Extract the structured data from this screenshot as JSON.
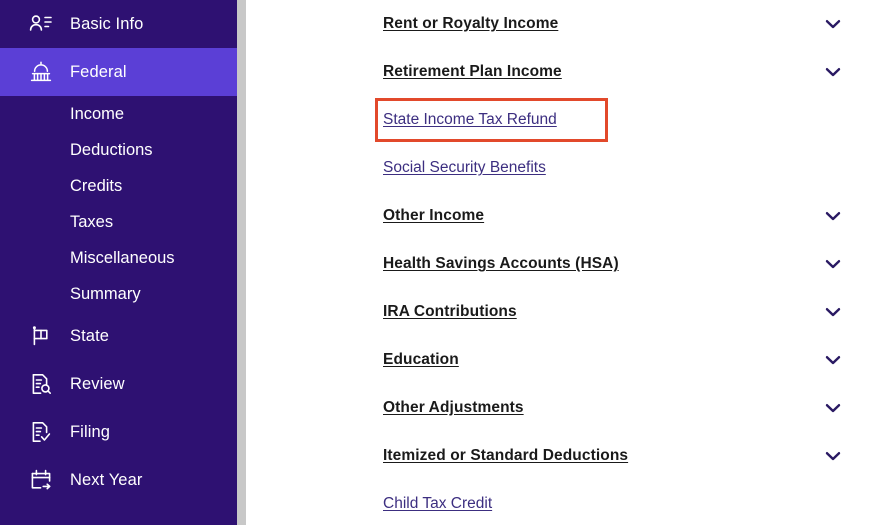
{
  "sidebar": {
    "items": [
      {
        "label": "Basic Info",
        "icon": "contact-card-icon",
        "active": false,
        "type": "nav"
      },
      {
        "label": "Federal",
        "icon": "capitol-building-icon",
        "active": true,
        "type": "nav"
      },
      {
        "label": "Income",
        "type": "sub"
      },
      {
        "label": "Deductions",
        "type": "sub"
      },
      {
        "label": "Credits",
        "type": "sub"
      },
      {
        "label": "Taxes",
        "type": "sub"
      },
      {
        "label": "Miscellaneous",
        "type": "sub"
      },
      {
        "label": "Summary",
        "type": "sub"
      },
      {
        "label": "State",
        "icon": "flag-icon",
        "active": false,
        "type": "nav"
      },
      {
        "label": "Review",
        "icon": "document-search-icon",
        "active": false,
        "type": "nav"
      },
      {
        "label": "Filing",
        "icon": "document-check-icon",
        "active": false,
        "type": "nav"
      },
      {
        "label": "Next Year",
        "icon": "calendar-arrow-icon",
        "active": false,
        "type": "nav"
      }
    ]
  },
  "main": {
    "items": [
      {
        "label": "Rent or Royalty Income",
        "style": "header",
        "chevron": true,
        "highlighted": false
      },
      {
        "label": "Retirement Plan Income",
        "style": "header",
        "chevron": true,
        "highlighted": false
      },
      {
        "label": "State Income Tax Refund",
        "style": "link",
        "chevron": false,
        "highlighted": true
      },
      {
        "label": "Social Security Benefits",
        "style": "link",
        "chevron": false,
        "highlighted": false
      },
      {
        "label": "Other Income",
        "style": "header",
        "chevron": true,
        "highlighted": false
      },
      {
        "label": "Health Savings Accounts (HSA)",
        "style": "header",
        "chevron": true,
        "highlighted": false
      },
      {
        "label": "IRA Contributions",
        "style": "header",
        "chevron": true,
        "highlighted": false
      },
      {
        "label": "Education",
        "style": "header",
        "chevron": true,
        "highlighted": false
      },
      {
        "label": "Other Adjustments",
        "style": "header",
        "chevron": true,
        "highlighted": false
      },
      {
        "label": "Itemized or Standard Deductions",
        "style": "header",
        "chevron": true,
        "highlighted": false
      },
      {
        "label": "Child Tax Credit",
        "style": "link",
        "chevron": false,
        "highlighted": false
      }
    ]
  },
  "colors": {
    "sidebar_background": "#2E1172",
    "sidebar_active": "#5B3FD6",
    "link_text": "#3C2E80",
    "header_text": "#1A1A1A",
    "chevron": "#2A1A63",
    "highlight_border": "#E2492B",
    "scrollbar_track": "#C8C8C8"
  }
}
